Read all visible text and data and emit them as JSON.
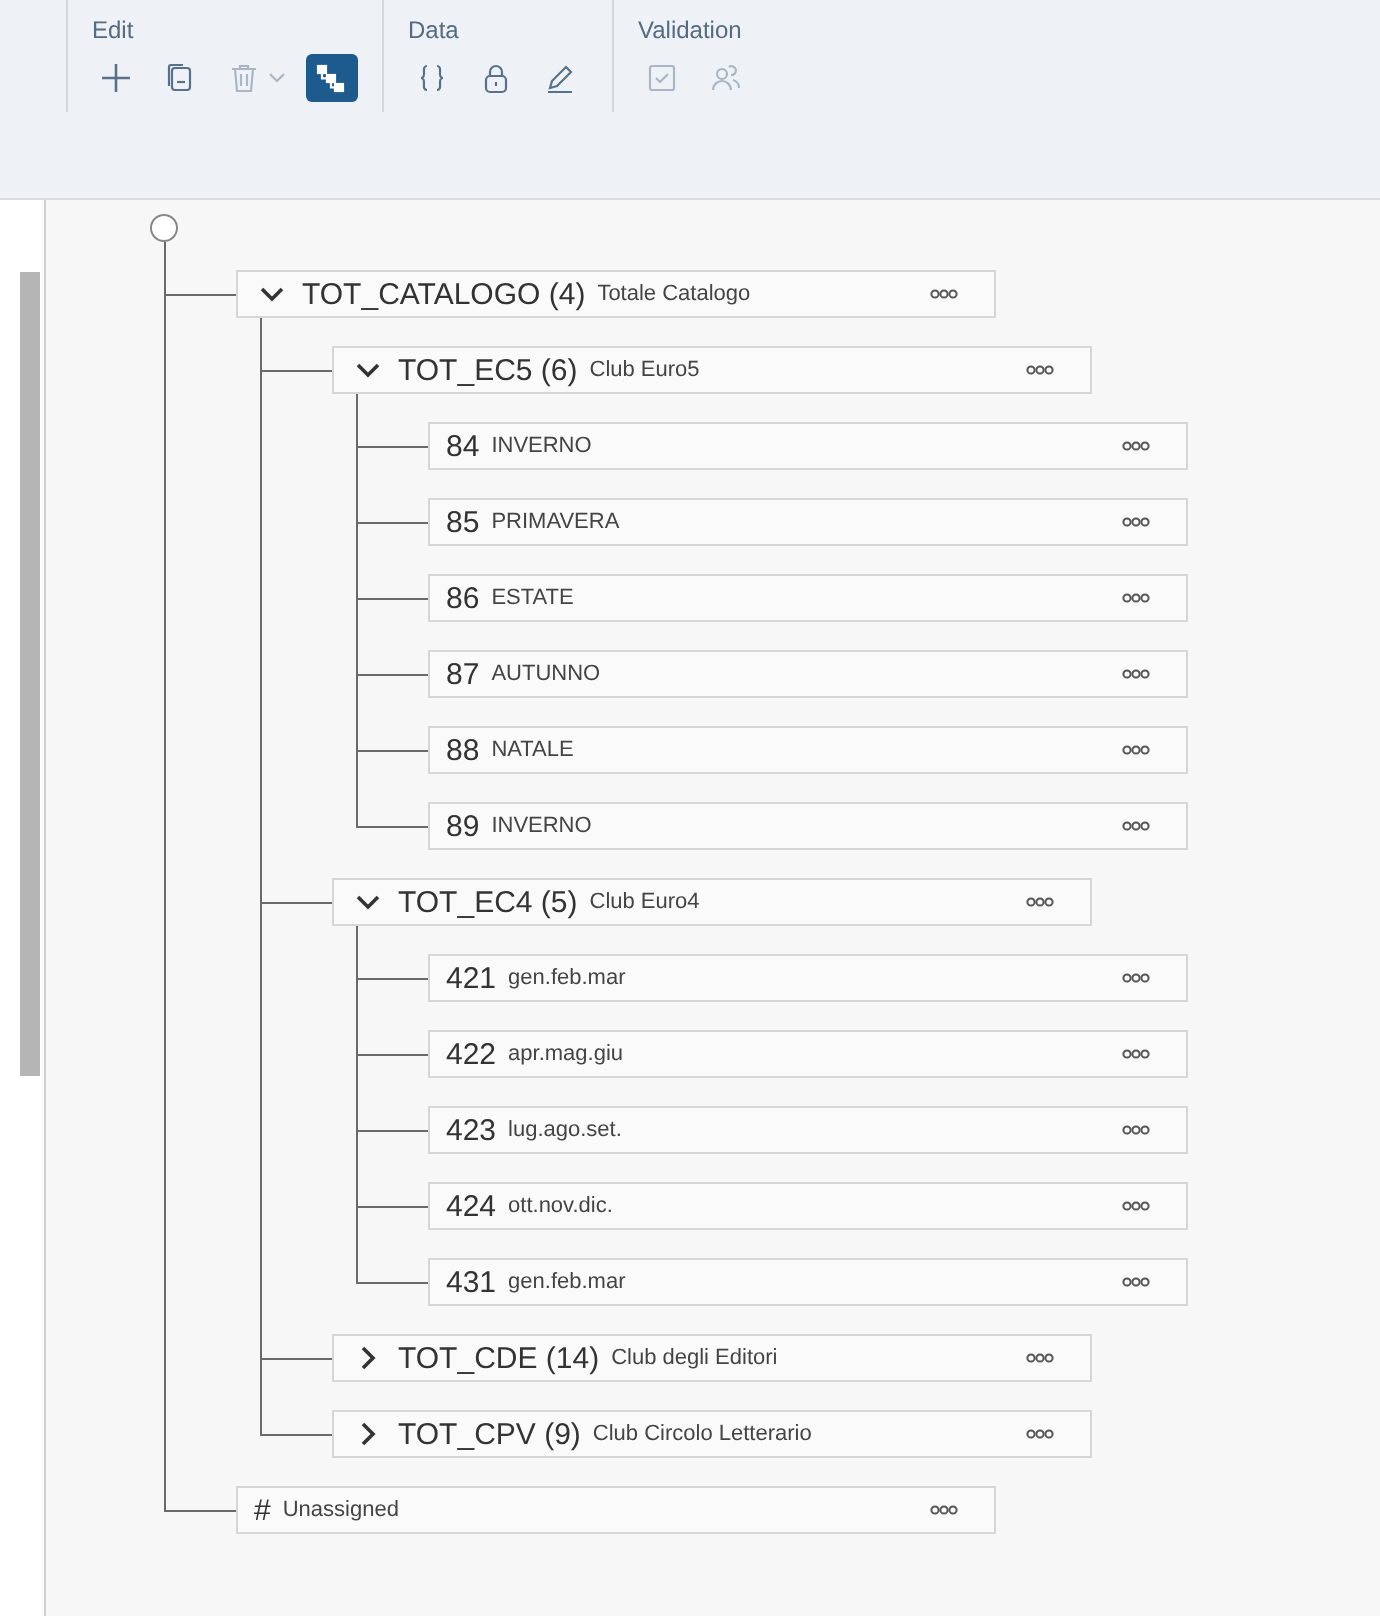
{
  "toolbar": {
    "groups": [
      {
        "label": "Edit",
        "tools": [
          {
            "kind": "add",
            "disabled": false,
            "selected": false
          },
          {
            "kind": "copy",
            "disabled": false,
            "selected": false
          },
          {
            "kind": "delete",
            "disabled": true,
            "selected": false
          },
          {
            "kind": "hierarchy",
            "disabled": false,
            "selected": true
          }
        ]
      },
      {
        "label": "Data",
        "tools": [
          {
            "kind": "braces",
            "disabled": false,
            "selected": false
          },
          {
            "kind": "lock",
            "disabled": false,
            "selected": false
          },
          {
            "kind": "pen",
            "disabled": false,
            "selected": false
          }
        ]
      },
      {
        "label": "Validation",
        "tools": [
          {
            "kind": "check",
            "disabled": true,
            "selected": false
          },
          {
            "kind": "people",
            "disabled": true,
            "selected": false
          }
        ]
      }
    ]
  },
  "tree": {
    "nodes": [
      {
        "kind": "group",
        "name": "TOT_CATALOGO (4)",
        "description": "Totale Catalogo",
        "expanded": true,
        "children": [
          {
            "kind": "group",
            "name": "TOT_EC5 (6)",
            "description": "Club Euro5",
            "expanded": true,
            "children": [
              {
                "kind": "leaf",
                "name": "84",
                "description": "INVERNO"
              },
              {
                "kind": "leaf",
                "name": "85",
                "description": "PRIMAVERA"
              },
              {
                "kind": "leaf",
                "name": "86",
                "description": "ESTATE"
              },
              {
                "kind": "leaf",
                "name": "87",
                "description": "AUTUNNO"
              },
              {
                "kind": "leaf",
                "name": "88",
                "description": "NATALE"
              },
              {
                "kind": "leaf",
                "name": "89",
                "description": "INVERNO"
              }
            ]
          },
          {
            "kind": "group",
            "name": "TOT_EC4 (5)",
            "description": "Club Euro4",
            "expanded": true,
            "children": [
              {
                "kind": "leaf",
                "name": "421",
                "description": "gen.feb.mar"
              },
              {
                "kind": "leaf",
                "name": "422",
                "description": "apr.mag.giu"
              },
              {
                "kind": "leaf",
                "name": "423",
                "description": "lug.ago.set."
              },
              {
                "kind": "leaf",
                "name": "424",
                "description": "ott.nov.dic."
              },
              {
                "kind": "leaf",
                "name": "431",
                "description": "gen.feb.mar"
              }
            ]
          },
          {
            "kind": "group",
            "name": "TOT_CDE (14)",
            "description": "Club degli Editori",
            "expanded": false
          },
          {
            "kind": "group",
            "name": "TOT_CPV (9)",
            "description": "Club Circolo Letterario",
            "expanded": false
          }
        ]
      },
      {
        "kind": "unassigned",
        "name": "#",
        "description": "Unassigned"
      }
    ]
  }
}
